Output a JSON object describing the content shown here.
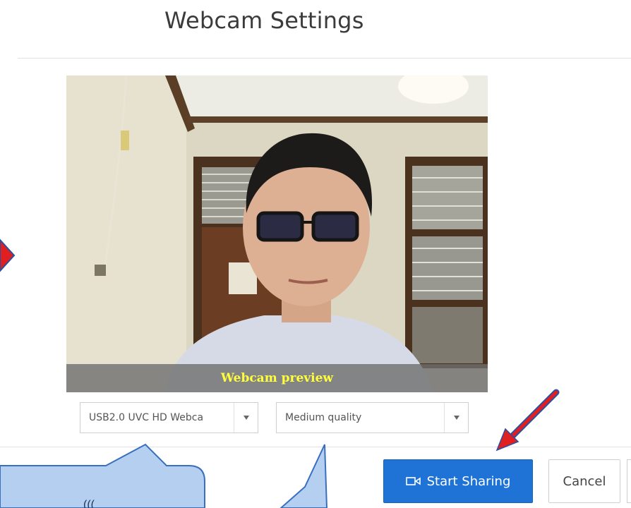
{
  "dialog": {
    "title": "Webcam Settings"
  },
  "preview": {
    "caption": "Webcam preview"
  },
  "device_select": {
    "selected": "USB2.0 UVC HD Webca"
  },
  "quality_select": {
    "selected": "Medium quality"
  },
  "buttons": {
    "start_sharing": "Start Sharing",
    "cancel": "Cancel"
  },
  "colors": {
    "primary": "#1f73d6",
    "caption_text": "#ffff3a",
    "annotation_red": "#e02020",
    "callout_blue": "#b4cff0",
    "callout_border": "#3a6fbf"
  },
  "icons": {
    "start_sharing_icon": "video-camera-icon",
    "select_caret": "caret-down-icon"
  }
}
